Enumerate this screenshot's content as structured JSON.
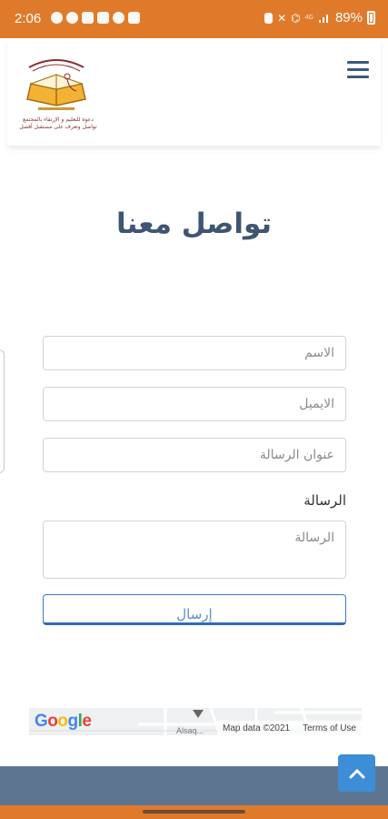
{
  "status_bar": {
    "time": "2:06",
    "battery": "89%",
    "network": "4G"
  },
  "header": {
    "logo_caption": "دعوة للتعليم و الإرتقاء بالمجتمع",
    "logo_subcaption": "تواصل وتعرف على مستقبل أفضل",
    "menu_icon": "hamburger-icon"
  },
  "page": {
    "title": "تواصل معنا"
  },
  "form": {
    "name_placeholder": "الاسم",
    "email_placeholder": "الايميل",
    "subject_placeholder": "عنوان الرسالة",
    "message_label": "الرسالة",
    "message_placeholder": "الرسالة",
    "submit_label": "إرسال"
  },
  "map": {
    "logo": "Google",
    "place": "Alsaq...",
    "map_data": "Map data ©2021",
    "terms": "Terms of Use"
  },
  "colors": {
    "status_bar": "#e07a2b",
    "title": "#3e5573",
    "footer": "#5d7590",
    "accent_button": "#3d8ed6"
  }
}
